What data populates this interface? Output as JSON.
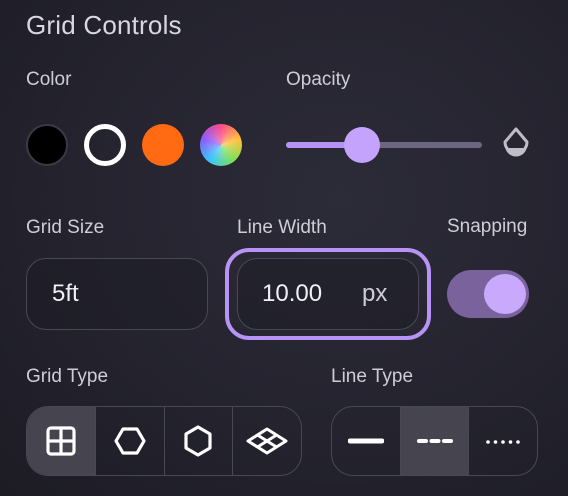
{
  "panel": {
    "title": "Grid Controls"
  },
  "color": {
    "label": "Color",
    "swatches": [
      {
        "name": "black",
        "hex": "#000000"
      },
      {
        "name": "white",
        "hex": "#ffffff"
      },
      {
        "name": "orange",
        "hex": "#ff6a13"
      },
      {
        "name": "custom-rainbow",
        "hex": "multicolor"
      }
    ],
    "selected": "white"
  },
  "opacity": {
    "label": "Opacity",
    "value": 0.38,
    "icon": "droplet-icon"
  },
  "grid_size": {
    "label": "Grid Size",
    "value": "5ft"
  },
  "line_width": {
    "label": "Line Width",
    "value": "10.00",
    "unit": "px",
    "focused": true
  },
  "snapping": {
    "label": "Snapping",
    "enabled": true
  },
  "grid_type": {
    "label": "Grid Type",
    "options": [
      "square-grid-icon",
      "hex-flat-icon",
      "hex-pointy-icon",
      "isometric-icon"
    ],
    "selected": "square-grid-icon"
  },
  "line_type": {
    "label": "Line Type",
    "options": [
      "solid-line-icon",
      "dashed-line-icon",
      "dotted-line-icon"
    ],
    "selected": "dashed-line-icon"
  },
  "accent_color": "#b692f5"
}
